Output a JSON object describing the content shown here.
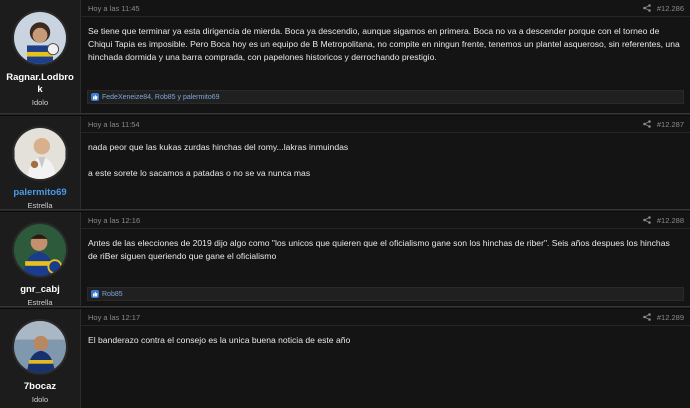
{
  "posts": [
    {
      "username": "Ragnar.Lodbrok",
      "role": "Idolo",
      "time": "Hoy a las 11:45",
      "number": "#12.286",
      "body": "Se tiene que terminar ya esta dirigencia de mierda. Boca ya descendio, aunque sigamos en primera. Boca no va a descender porque con el torneo de Chiqui Tapia es imposible. Pero Boca hoy es un equipo de B Metropolitana, no compite en ningun frente, tenemos un plantel asqueroso, sin referentes, una hinchada dormida y una barra comprada, con papelones historicos y derrochando prestigio.",
      "reactions": "FedeXeneize84, Rob85 y palermito69"
    },
    {
      "username": "palermito69",
      "role": "Estrella",
      "time": "Hoy a las 11:54",
      "number": "#12.287",
      "body": "nada peor que las kukas zurdas hinchas del romy...lakras inmuindas\n\na este sorete lo sacamos a patadas o no se va nunca mas",
      "reactions": ""
    },
    {
      "username": "gnr_cabj",
      "role": "Estrella",
      "time": "Hoy a las 12:16",
      "number": "#12.288",
      "body": "Antes de las elecciones de 2019 dijo algo como \"los unicos que quieren que el oficialismo gane son los hinchas de riber\". Seis años despues los hinchas de riBer siguen queriendo que gane el oficialismo",
      "reactions": "Rob85"
    },
    {
      "username": "7bocaz",
      "role": "Idolo",
      "time": "Hoy a las 12:17",
      "number": "#12.289",
      "body": "El banderazo contra el consejo es la unica buena noticia de este año",
      "reactions": ""
    }
  ],
  "colors": {
    "username_default": "#ffffff",
    "username_highlight": "#4c9be8",
    "like_blue": "#3a7bd5"
  },
  "icons": [
    "share-icon",
    "like-icon",
    "avatar"
  ]
}
